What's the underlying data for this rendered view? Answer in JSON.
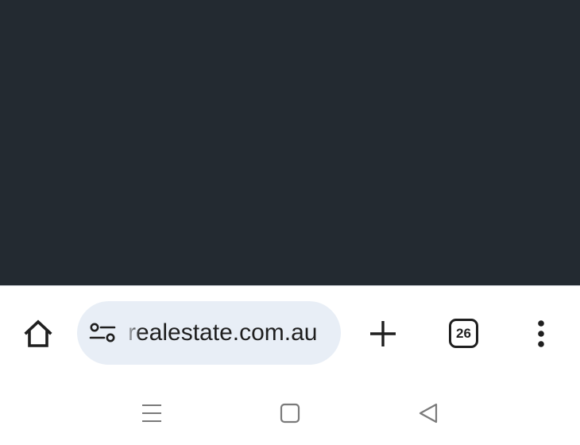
{
  "browser": {
    "address_bar": {
      "url": "realestate.com.au",
      "site_settings_icon": "tune-icon"
    },
    "toolbar": {
      "home_icon": "home-icon",
      "new_tab_icon": "plus-icon",
      "tab_count": "26",
      "menu_icon": "more-vert-icon"
    }
  },
  "system_nav": {
    "recents_icon": "recents-icon",
    "home_icon": "square-icon",
    "back_icon": "back-triangle-icon"
  },
  "colors": {
    "page_background": "#232a31",
    "omnibox_background": "#e8eef6",
    "icon_color": "#1f1f1f",
    "nav_icon_color": "#7a7a7a"
  }
}
